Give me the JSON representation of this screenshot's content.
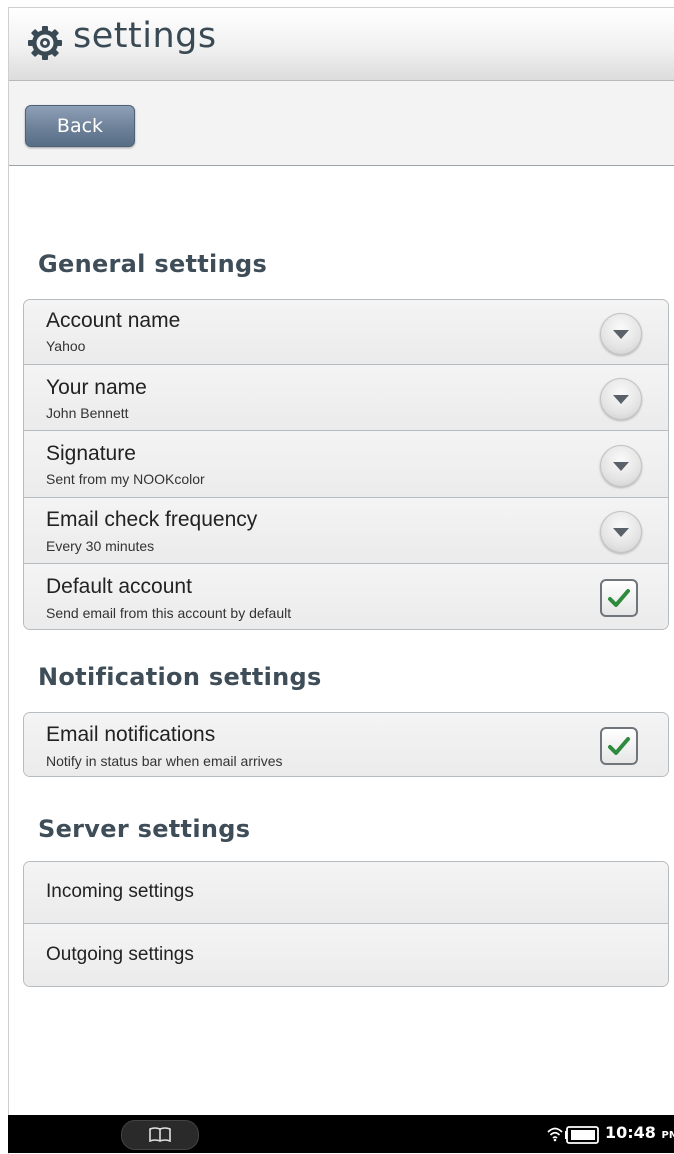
{
  "header": {
    "title": "settings",
    "icon": "gear-icon"
  },
  "toolbar": {
    "back_label": "Back"
  },
  "general": {
    "heading": "General settings",
    "rows": [
      {
        "title": "Account name",
        "subtitle": "Yahoo",
        "control": "dropdown"
      },
      {
        "title": "Your name",
        "subtitle": "John Bennett",
        "control": "dropdown"
      },
      {
        "title": "Signature",
        "subtitle": "Sent from my NOOKcolor",
        "control": "dropdown"
      },
      {
        "title": "Email check frequency",
        "subtitle": "Every 30 minutes",
        "control": "dropdown"
      },
      {
        "title": "Default account",
        "subtitle": "Send email from this account by default",
        "control": "checkbox",
        "checked": true
      }
    ]
  },
  "notification": {
    "heading": "Notification settings",
    "rows": [
      {
        "title": "Email notifications",
        "subtitle": "Notify in status bar when email arrives",
        "control": "checkbox",
        "checked": true
      }
    ]
  },
  "server": {
    "heading": "Server settings",
    "rows": [
      {
        "title": "Incoming settings"
      },
      {
        "title": "Outgoing settings"
      }
    ]
  },
  "statusbar": {
    "time": "10:48",
    "ampm": "PM",
    "icons": [
      "book-icon",
      "wifi-icon",
      "battery-icon"
    ]
  },
  "colors": {
    "heading_text": "#3e4d57",
    "back_button": "#6d8199",
    "check": "#2e8b3e"
  }
}
